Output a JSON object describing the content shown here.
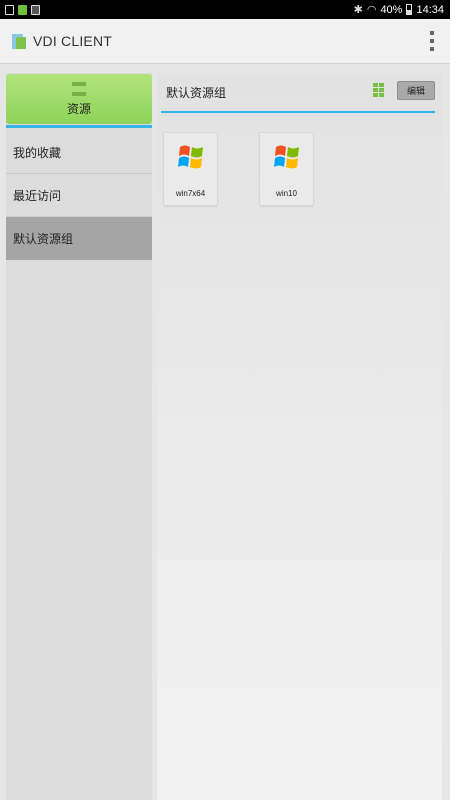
{
  "status_bar": {
    "battery_percent": "40%",
    "time": "14:34"
  },
  "app_bar": {
    "title": "VDI CLIENT"
  },
  "sidebar": {
    "resources_tab_label": "资源",
    "items": [
      {
        "label": "我的收藏"
      },
      {
        "label": "最近访问"
      },
      {
        "label": "默认资源组",
        "selected": true
      }
    ]
  },
  "main": {
    "group_title": "默认资源组",
    "edit_label": "编辑",
    "resources": [
      {
        "name": "win7x64",
        "icon": "windows-icon"
      },
      {
        "name": "win10",
        "icon": "windows-icon"
      }
    ]
  },
  "colors": {
    "accent_blue": "#33b5e5",
    "tab_green": "#8ed35a",
    "selected_gray": "#a5a5a5"
  }
}
